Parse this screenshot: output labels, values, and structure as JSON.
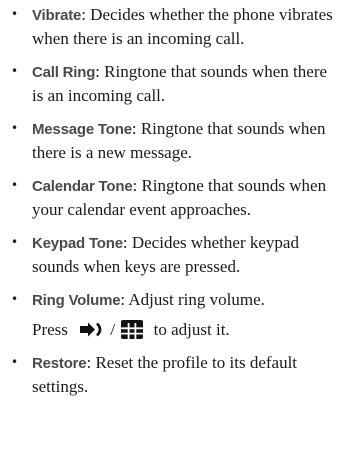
{
  "items": [
    {
      "term": "Vibrate",
      "desc": ": Decides whether the phone vibrates when there is an incoming call."
    },
    {
      "term": "Call Ring",
      "desc": ": Ringtone that sounds when there is an incoming call."
    },
    {
      "term": "Message Tone",
      "desc": ": Ringtone that sounds when there is a new message."
    },
    {
      "term": "Calendar Tone",
      "desc": ": Ringtone that sounds when your calendar event approaches."
    },
    {
      "term": "Keypad Tone",
      "desc": ": Decides whether keypad sounds when keys are pressed."
    },
    {
      "term": "Ring Volume",
      "desc": ": Adjust ring volume.",
      "note_prefix": "Press",
      "note_sep": "/",
      "note_suffix": "to adjust it."
    },
    {
      "term": "Restore",
      "desc": ": Reset the profile to its default settings."
    }
  ],
  "icons": {
    "volume": "volume-key-icon",
    "keypad": "keypad-icon"
  }
}
